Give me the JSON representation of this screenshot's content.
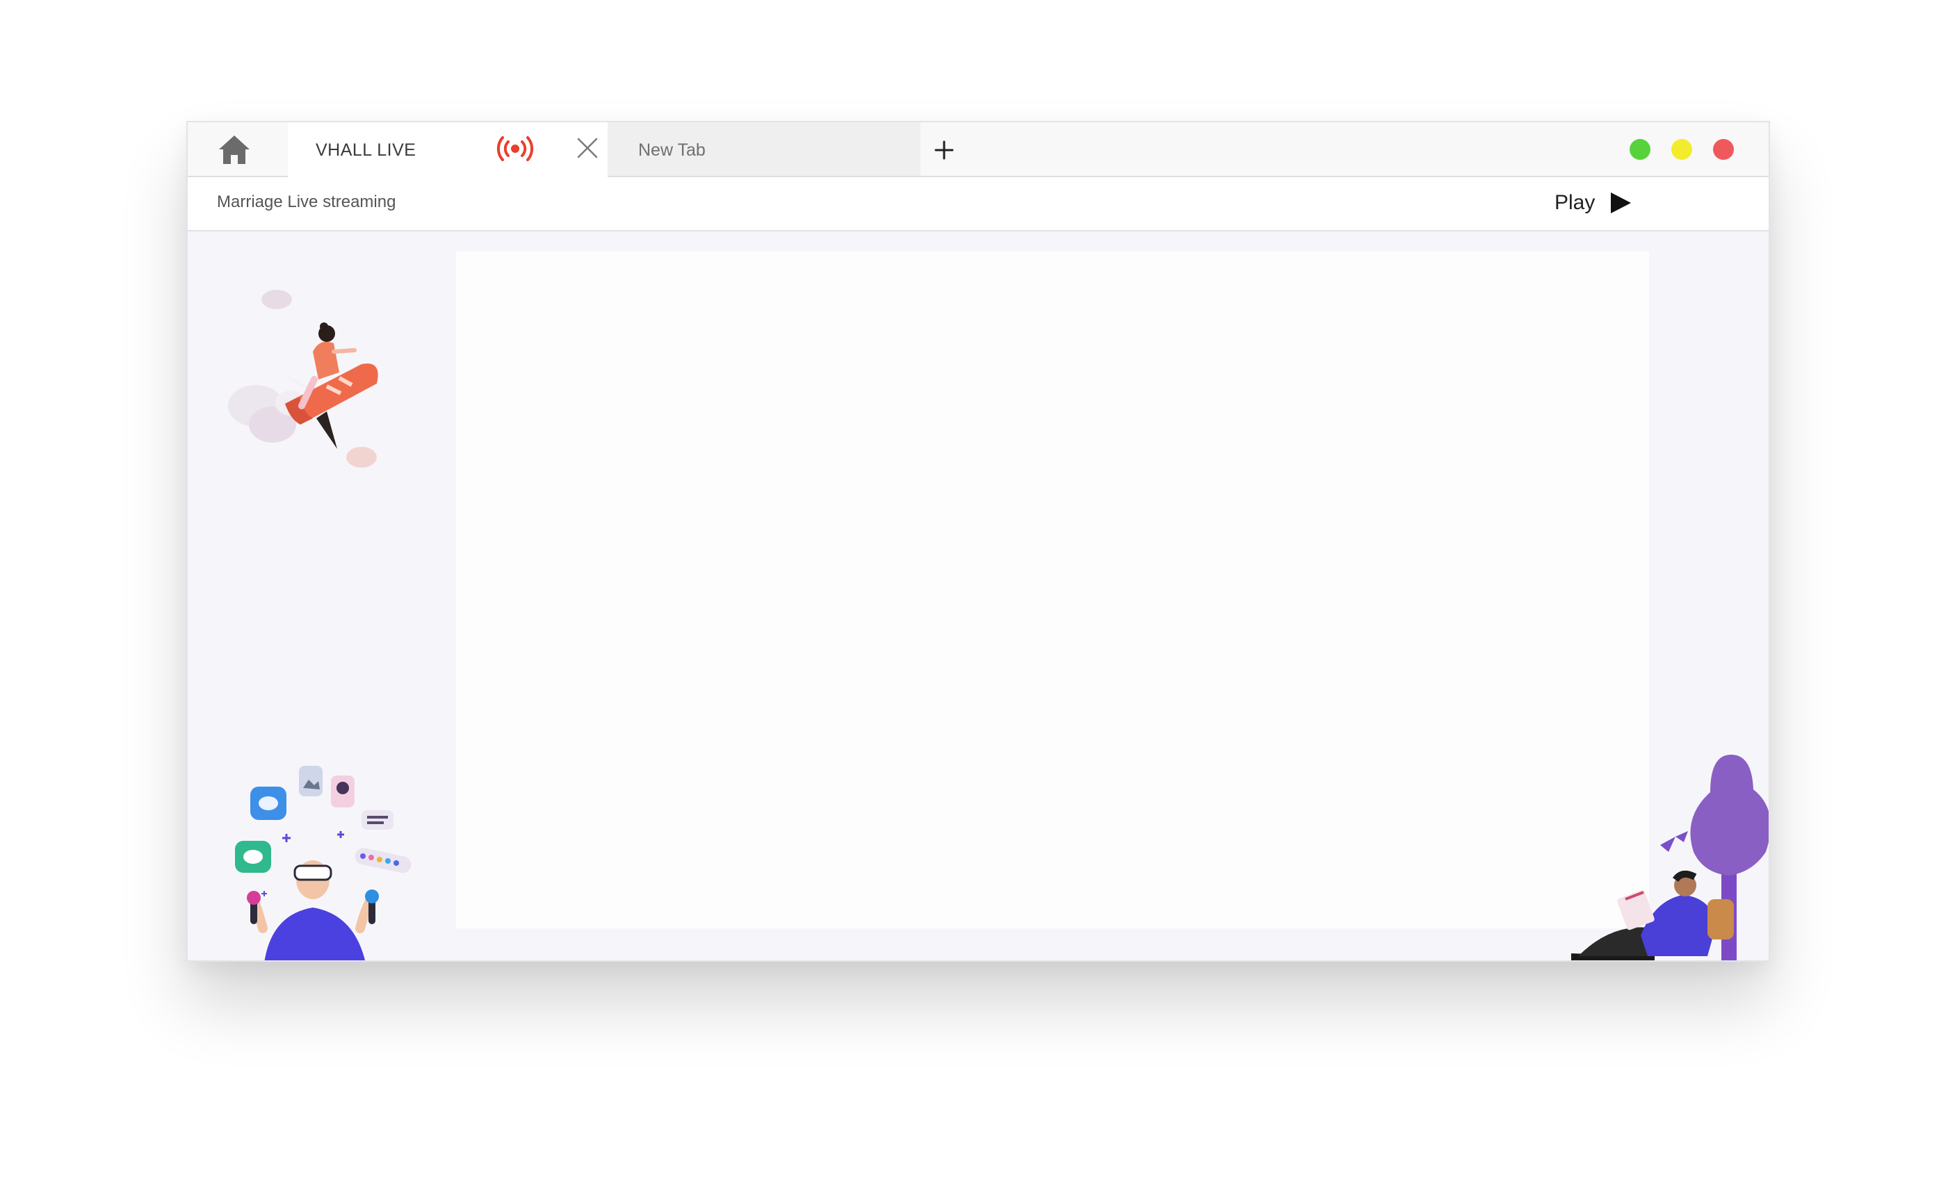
{
  "tabs": [
    {
      "label": "VHALL LIVE",
      "active": true,
      "live_indicator": "broadcast-icon",
      "live_color": "#e8402e"
    },
    {
      "label": "New Tab",
      "active": false
    }
  ],
  "icons": {
    "home": "home-icon",
    "close": "close-icon",
    "new_tab": "plus-icon",
    "play": "play-icon"
  },
  "window_controls": {
    "colors": [
      "#56d33a",
      "#f2ec2d",
      "#f0595c"
    ]
  },
  "toolbar": {
    "page_title": "Marriage Live streaming",
    "play_label": "Play"
  },
  "illustrations": [
    "rocket-rider-illustration",
    "vr-user-illustration",
    "reader-tree-illustration"
  ]
}
